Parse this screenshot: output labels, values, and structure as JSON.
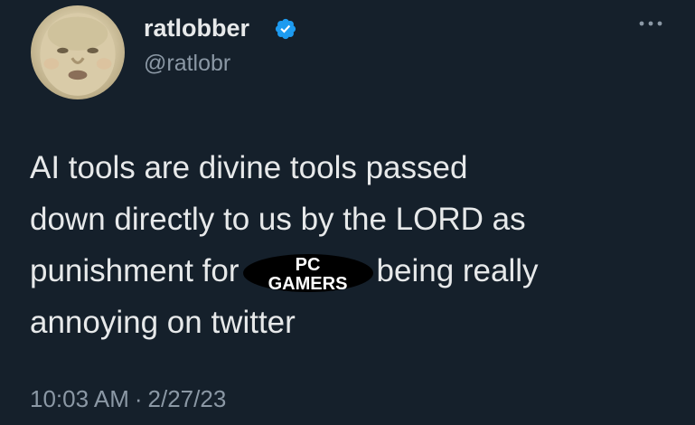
{
  "author": {
    "display_name": "ratlobber",
    "handle": "@ratlobr",
    "verified": true,
    "avatar_icon": "baby-face-avatar"
  },
  "more_menu_icon": "more-horizontal-icon",
  "tweet": {
    "lines": [
      "AI tools are divine tools passed",
      "down directly to us by the LORD as",
      "punishment for",
      "being really",
      "annoying on twitter"
    ],
    "censor_label": "PC\nGAMERS"
  },
  "meta": {
    "time": "10:03 AM",
    "separator": "·",
    "date": "2/27/23"
  },
  "colors": {
    "background": "#15202b",
    "primary_text": "#e7e9ea",
    "secondary_text": "#8b98a5",
    "verified_blue": "#1d9bf0"
  }
}
